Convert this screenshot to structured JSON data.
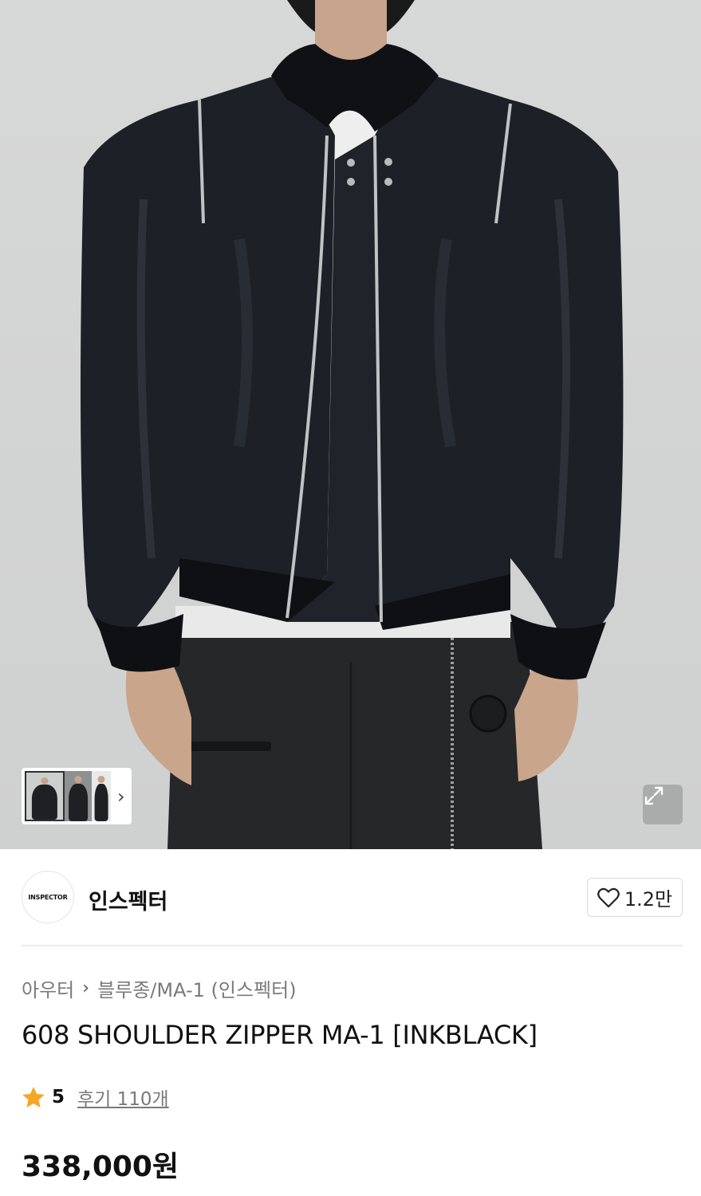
{
  "brand": {
    "logo_text": "INSPECTOR",
    "name": "인스펙터",
    "likes": "1.2만"
  },
  "breadcrumb": {
    "category": "아우터",
    "subcategory": "블루종/MA-1 (인스펙터)"
  },
  "product": {
    "title": "608 SHOULDER ZIPPER MA-1 [INKBLACK]",
    "rating": "5",
    "reviews": "후기 110개",
    "price": "338,000원"
  },
  "gallery": {
    "more_icon": "chevron-right-icon",
    "expand_icon": "expand-icon"
  },
  "colors": {
    "star": "#F5A623",
    "jacket": "#1d2026",
    "background": "#d4d5d5"
  }
}
